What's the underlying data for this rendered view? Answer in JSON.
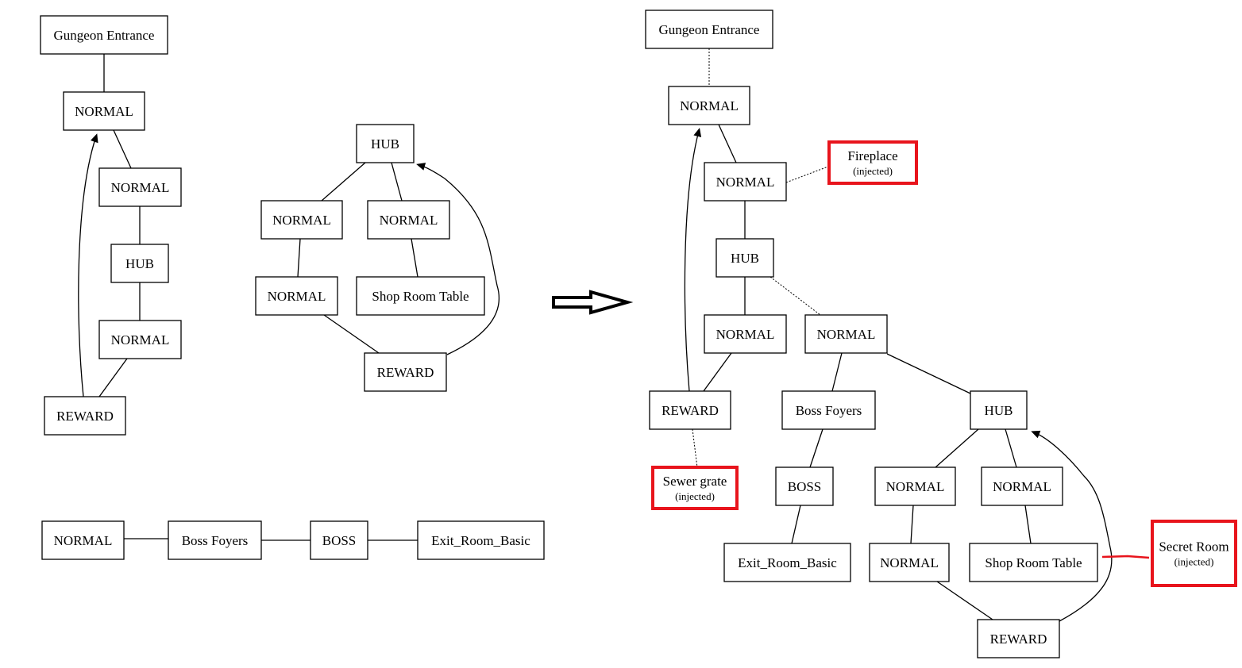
{
  "graphs": {
    "left_main": {
      "nodes": [
        {
          "id": "L1",
          "label": "Gungeon Entrance"
        },
        {
          "id": "L2",
          "label": "NORMAL"
        },
        {
          "id": "L3",
          "label": "NORMAL"
        },
        {
          "id": "L4",
          "label": "HUB"
        },
        {
          "id": "L5",
          "label": "NORMAL"
        },
        {
          "id": "L6",
          "label": "REWARD"
        }
      ],
      "edges": [
        {
          "from": "L1",
          "to": "L2",
          "style": "solid"
        },
        {
          "from": "L2",
          "to": "L3",
          "style": "solid"
        },
        {
          "from": "L3",
          "to": "L4",
          "style": "solid"
        },
        {
          "from": "L4",
          "to": "L5",
          "style": "solid"
        },
        {
          "from": "L5",
          "to": "L6",
          "style": "solid"
        },
        {
          "from": "L6",
          "to": "L2",
          "style": "arrow"
        }
      ]
    },
    "middle_loop": {
      "nodes": [
        {
          "id": "M1",
          "label": "HUB"
        },
        {
          "id": "M2",
          "label": "NORMAL"
        },
        {
          "id": "M3",
          "label": "NORMAL"
        },
        {
          "id": "M4",
          "label": "NORMAL"
        },
        {
          "id": "M5",
          "label": "Shop Room Table"
        },
        {
          "id": "M6",
          "label": "REWARD"
        }
      ],
      "edges": [
        {
          "from": "M1",
          "to": "M2",
          "style": "solid"
        },
        {
          "from": "M1",
          "to": "M3",
          "style": "solid"
        },
        {
          "from": "M2",
          "to": "M4",
          "style": "solid"
        },
        {
          "from": "M3",
          "to": "M5",
          "style": "solid"
        },
        {
          "from": "M4",
          "to": "M6",
          "style": "solid"
        },
        {
          "from": "M6",
          "to": "M1",
          "style": "arrow"
        }
      ]
    },
    "boss_chain": {
      "nodes": [
        {
          "id": "N1",
          "label": "NORMAL"
        },
        {
          "id": "N2",
          "label": "Boss Foyers"
        },
        {
          "id": "N3",
          "label": "BOSS"
        },
        {
          "id": "N4",
          "label": "Exit_Room_Basic"
        }
      ],
      "edges": [
        {
          "from": "N1",
          "to": "N2",
          "style": "solid"
        },
        {
          "from": "N2",
          "to": "N3",
          "style": "solid"
        },
        {
          "from": "N3",
          "to": "N4",
          "style": "solid"
        }
      ]
    },
    "result": {
      "nodes": [
        {
          "id": "R1",
          "label": "Gungeon Entrance"
        },
        {
          "id": "R2",
          "label": "NORMAL"
        },
        {
          "id": "R3",
          "label": "NORMAL"
        },
        {
          "id": "F",
          "label": "Fireplace",
          "sublabel": "(injected)",
          "injected": true
        },
        {
          "id": "R4",
          "label": "HUB"
        },
        {
          "id": "R5",
          "label": "NORMAL"
        },
        {
          "id": "R6",
          "label": "NORMAL"
        },
        {
          "id": "R7",
          "label": "REWARD"
        },
        {
          "id": "S",
          "label": "Sewer grate",
          "sublabel": "(injected)",
          "injected": true
        },
        {
          "id": "R8",
          "label": "Boss Foyers"
        },
        {
          "id": "R9",
          "label": "HUB"
        },
        {
          "id": "R10",
          "label": "BOSS"
        },
        {
          "id": "R11",
          "label": "Exit_Room_Basic"
        },
        {
          "id": "R12",
          "label": "NORMAL"
        },
        {
          "id": "R13",
          "label": "NORMAL"
        },
        {
          "id": "R14",
          "label": "NORMAL"
        },
        {
          "id": "R15",
          "label": "Shop Room Table"
        },
        {
          "id": "R16",
          "label": "REWARD"
        },
        {
          "id": "X",
          "label": "Secret Room",
          "sublabel": "(injected)",
          "injected": true
        }
      ],
      "edges": [
        {
          "from": "R1",
          "to": "R2",
          "style": "dotted"
        },
        {
          "from": "R2",
          "to": "R3",
          "style": "solid"
        },
        {
          "from": "R3",
          "to": "F",
          "style": "dotted"
        },
        {
          "from": "R3",
          "to": "R4",
          "style": "solid"
        },
        {
          "from": "R4",
          "to": "R5",
          "style": "solid"
        },
        {
          "from": "R4",
          "to": "R6",
          "style": "dotted"
        },
        {
          "from": "R5",
          "to": "R7",
          "style": "solid"
        },
        {
          "from": "R7",
          "to": "R2",
          "style": "arrow"
        },
        {
          "from": "R7",
          "to": "S",
          "style": "dotted"
        },
        {
          "from": "R6",
          "to": "R8",
          "style": "solid"
        },
        {
          "from": "R6",
          "to": "R9",
          "style": "solid"
        },
        {
          "from": "R8",
          "to": "R10",
          "style": "solid"
        },
        {
          "from": "R10",
          "to": "R11",
          "style": "solid"
        },
        {
          "from": "R9",
          "to": "R12",
          "style": "solid"
        },
        {
          "from": "R9",
          "to": "R13",
          "style": "solid"
        },
        {
          "from": "R12",
          "to": "R14",
          "style": "solid"
        },
        {
          "from": "R13",
          "to": "R15",
          "style": "solid"
        },
        {
          "from": "R14",
          "to": "R16",
          "style": "solid"
        },
        {
          "from": "R16",
          "to": "R9",
          "style": "arrow"
        },
        {
          "from": "R15",
          "to": "X",
          "style": "red"
        }
      ]
    }
  },
  "transform_arrow": "right-arrow-icon",
  "colors": {
    "injected_highlight": "#e8141c",
    "line": "#000000"
  }
}
